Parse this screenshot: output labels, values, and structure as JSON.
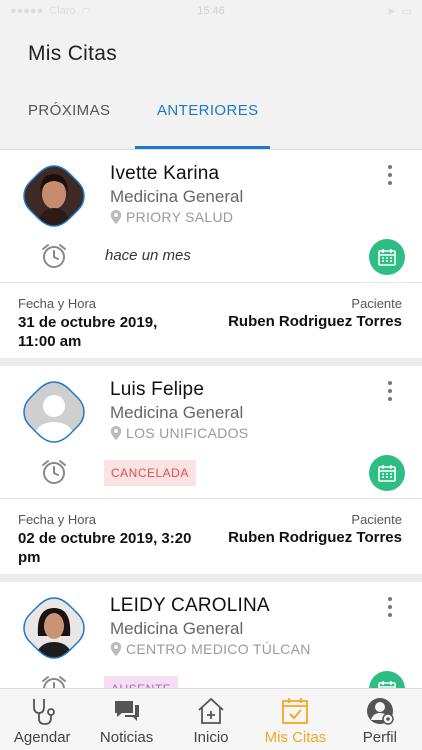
{
  "status_bar": {
    "carrier": "Claro",
    "time": "15:46",
    "battery": ""
  },
  "header": {
    "title": "Mis Citas"
  },
  "tabs": [
    {
      "label": "PRÓXIMAS",
      "active": false
    },
    {
      "label": "ANTERIORES",
      "active": true
    }
  ],
  "appointments": [
    {
      "doctor": "Ivette Karina",
      "specialty": "Medicina General",
      "location": "PRIORY SALUD",
      "status_text": "hace un mes",
      "badge": "",
      "date_label": "Fecha y Hora",
      "date_value": "31 de octubre 2019, 11:00 am",
      "patient_label": "Paciente",
      "patient_value": "Ruben Rodriguez Torres",
      "avatar": "photo-woman-1"
    },
    {
      "doctor": "Luis Felipe",
      "specialty": "Medicina General",
      "location": "LOS UNIFICADOS",
      "status_text": "",
      "badge": "CANCELADA",
      "date_label": "Fecha y Hora",
      "date_value": "02 de octubre 2019, 3:20 pm",
      "patient_label": "Paciente",
      "patient_value": "Ruben Rodriguez Torres",
      "avatar": "placeholder-person"
    },
    {
      "doctor": "LEIDY CAROLINA",
      "specialty": "Medicina General",
      "location": "CENTRO MEDICO TÚLCAN",
      "status_text": "",
      "badge": "AUSENTE",
      "avatar": "photo-woman-2"
    }
  ],
  "bottom_nav": [
    {
      "label": "Agendar",
      "icon": "stethoscope-icon",
      "active": false
    },
    {
      "label": "Noticias",
      "icon": "chat-bubbles-icon",
      "active": false
    },
    {
      "label": "Inicio",
      "icon": "home-icon",
      "active": false
    },
    {
      "label": "Mis Citas",
      "icon": "calendar-check-icon",
      "active": true
    },
    {
      "label": "Perfil",
      "icon": "profile-gear-icon",
      "active": false
    }
  ],
  "colors": {
    "accent_blue": "#1f78c8",
    "accent_orange": "#f5a623",
    "green": "#2ebd82"
  }
}
